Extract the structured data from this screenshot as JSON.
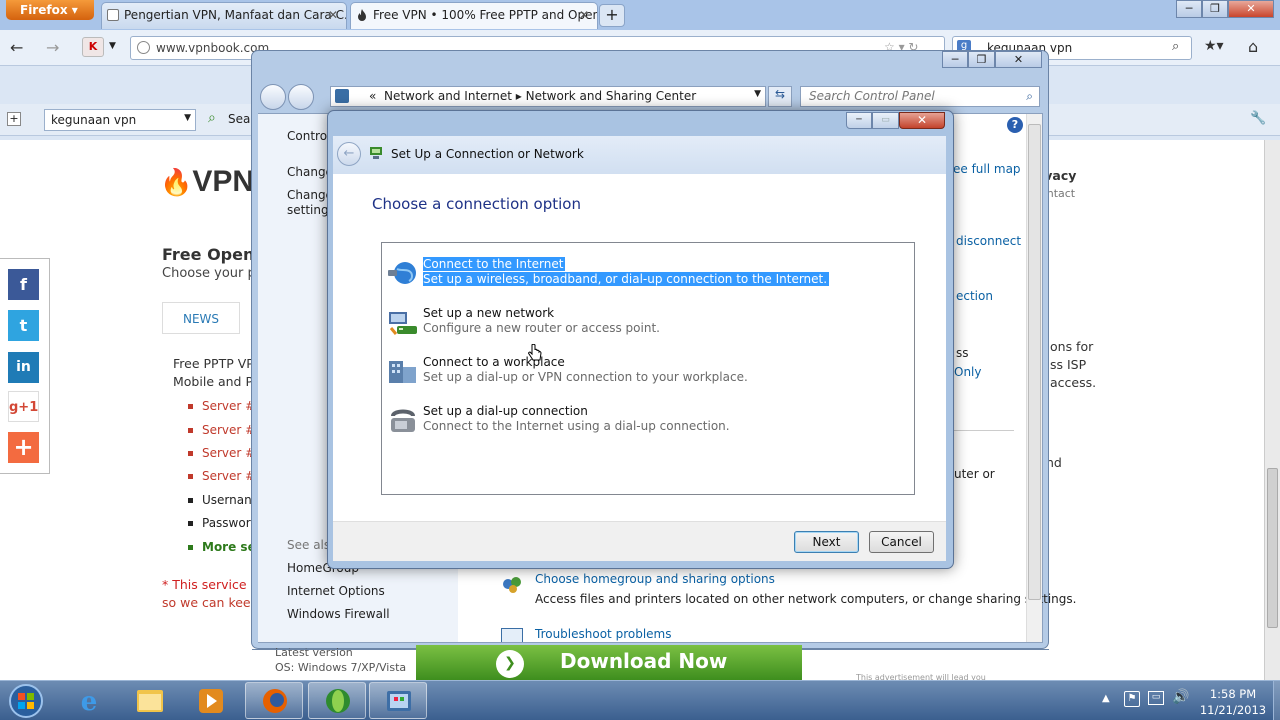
{
  "firefox": {
    "menu_label": "Firefox",
    "tabs": [
      {
        "title": "Pengertian VPN, Manfaat dan Cara C..."
      },
      {
        "title": "Free VPN • 100% Free PPTP and Open..."
      }
    ],
    "new_tab_label": "+",
    "url": "www.vpnbook.com",
    "search_query": "kegunaan vpn",
    "toolbar_search_value": "kegunaan vpn",
    "toolbar_search_label": "Search"
  },
  "webpage": {
    "logo_text": "VPN",
    "heading": "Free OpenV",
    "subheading": "Choose your p",
    "news_tab": "NEWS",
    "intro_line1": "Free PPTP VP",
    "intro_line2": "Mobile and P",
    "servers": [
      "Server #",
      "Server #",
      "Server #",
      "Server #"
    ],
    "username_label": "Usernan",
    "password_label": "Passwor",
    "more_servers": "More ser",
    "service_note_line1": "* This service i",
    "service_note_line2": "so we can keep",
    "social": [
      "f",
      "t",
      "in",
      "g+1",
      "+"
    ],
    "right_lines": [
      "ivacy",
      "ontact"
    ],
    "right_lines2": [
      "ons for",
      "ss ISP",
      "access.",
      "",
      "",
      "nd"
    ],
    "latest_version": "Latest version",
    "os_label": "OS: Windows 7/XP/Vista",
    "download_label": "Download Now",
    "ad_note": "This advertisement will lead you"
  },
  "control_panel": {
    "breadcrumb_root": "«",
    "breadcrumb_1": "Network and Internet",
    "breadcrumb_2": "Network and Sharing Center",
    "search_placeholder": "Search Control Panel",
    "left_items": [
      "Control",
      "Change",
      "Change",
      "settings"
    ],
    "see_also": "See also",
    "see_also_links": [
      "HomeGroup",
      "Internet Options",
      "Windows Firewall"
    ],
    "right_links": [
      "ee full map",
      "disconnect",
      "ection",
      "ss",
      "Only",
      "uter or"
    ],
    "task_homegroup_title": "Choose homegroup and sharing options",
    "task_homegroup_desc": "Access files and printers located on other network computers, or change sharing settings.",
    "task_troubleshoot_title": "Troubleshoot problems"
  },
  "dialog": {
    "title": "Set Up a Connection or Network",
    "heading": "Choose a connection option",
    "options": [
      {
        "title": "Connect to the Internet",
        "desc": "Set up a wireless, broadband, or dial-up connection to the Internet.",
        "icon": "globe-icon",
        "selected": true
      },
      {
        "title": "Set up a new network",
        "desc": "Configure a new router or access point.",
        "icon": "router-icon",
        "selected": false
      },
      {
        "title": "Connect to a workplace",
        "desc": "Set up a dial-up or VPN connection to your workplace.",
        "icon": "workplace-icon",
        "selected": false
      },
      {
        "title": "Set up a dial-up connection",
        "desc": "Connect to the Internet using a dial-up connection.",
        "icon": "phone-icon",
        "selected": false
      }
    ],
    "next_label": "Next",
    "cancel_label": "Cancel"
  },
  "taskbar": {
    "time": "1:58 PM",
    "date": "11/21/2013"
  },
  "colors": {
    "selection": "#3399ff",
    "heading_blue": "#1e3287",
    "link_blue": "#0b61a4"
  }
}
